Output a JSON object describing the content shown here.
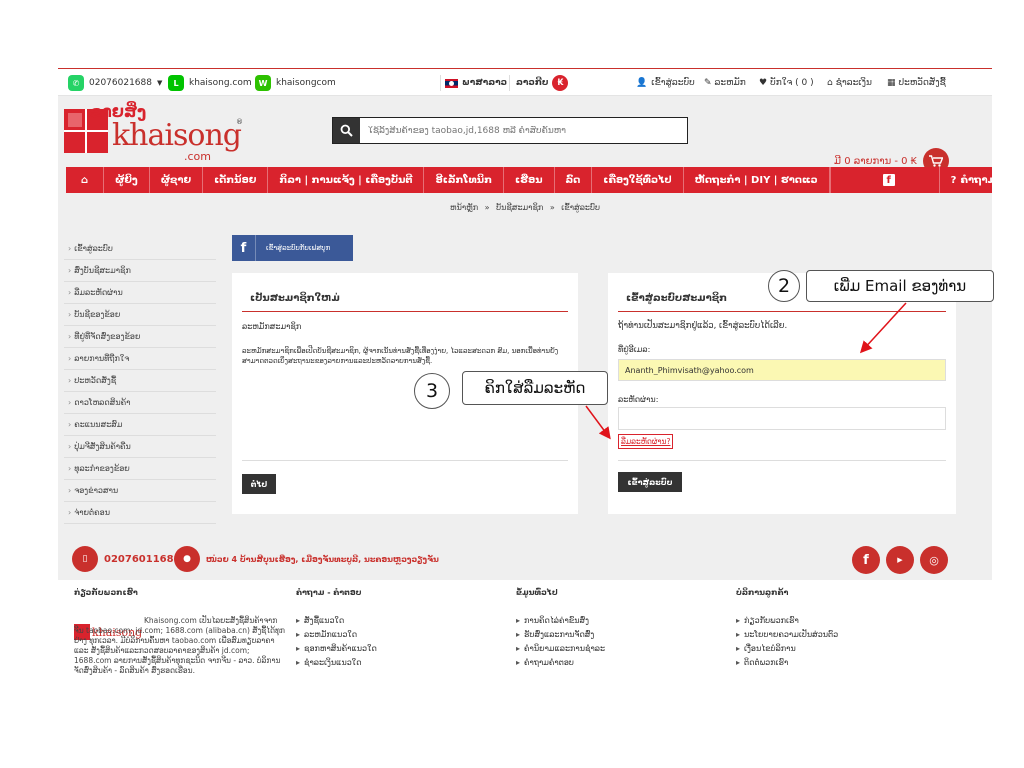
{
  "topbar": {
    "phone": "02076021688",
    "line_id": "khaisong.com",
    "wechat_id": "khaisongcom",
    "language": "ພາສາລາວ",
    "currency": "ລາວກີບ",
    "currency_symbol": "₭",
    "login": "ເຂົ້າສູ່ລະບົບ",
    "register": "ລະຫມັກ",
    "wishlist": "ບັກໃຈ ( 0 )",
    "checkout": "ຊຳລະເງິນ",
    "history": "ປະຫວັດສັ່ງຊື້"
  },
  "header": {
    "logo_lao": "ຂາຍສິ່ງ",
    "logo_main": "khaisong",
    "logo_com": ".com",
    "logo_reg": "®",
    "search_placeholder": "ໃຊ້ລິ້ງສິນຄ້າຂອງ taobao,jd,1688 ຫລື ຄຳສັບຄົ້ນຫາ",
    "cart_text": "ມີ 0 ລາຍການ - 0 ₭"
  },
  "nav": {
    "items": [
      "ຜູ້ຍິງ",
      "ຜູ້ຊາຍ",
      "ເດັກນ້ອຍ",
      "ກິລາ | ການແຈ້ງ | ເຄື່ອງບັນຕີ",
      "ອີເລັກໂທນິກ",
      "ເຮືອນ",
      "ລົດ",
      "ເຄື່ອງໃຊ້ທົ່ວໄປ",
      "ຫັດຖະກຳ | DIY | ຮາດແວ"
    ],
    "help": "ຄຳຖາມທີ່ພົບຫຼາຍ"
  },
  "breadcrumb": {
    "home": "ຫນ້າຫຼັກ",
    "account": "ບັນຊີສະມາຊິກ",
    "current": "ເຂົ້າສູ່ລະບົບ",
    "sep": "»"
  },
  "sidebar": {
    "items": [
      "ເຂົ້າສູ່ລະບົບ",
      "ສົ່ງບັນຊີສະມາຊິກ",
      "ລືມລະຫັດຜ່ານ",
      "ບັນຊີຂອງຂ້ອຍ",
      "ທີ່ຢູ່ທີ່ຈັດສົ່ງຂອງຂ້ອຍ",
      "ລາຍການທີ່ຖືກໃຈ",
      "ປະຫວັດສັ່ງຊື້",
      "ດາວໂຫລດສິນຄ້າ",
      "ຄະແນນສະສົມ",
      "ປຸ່ມຈີສັ່ງສິນຄ້າຄືນ",
      "ທຸລະກຳຂອງຂ້ອຍ",
      "ຈອງຂ່າວສານ",
      "ຈ່າຍຕໍ່ຄອນ"
    ]
  },
  "facebook_login": "ເຂົ້າສູ່ລະບົບກັບເຟສບຸກ",
  "new_customer": {
    "heading": "ເປັນສະມາຊິກໃຫມ່",
    "subheading": "ລະຫມັກສະມາຊິກ",
    "body": "ລະຫມັກສະມາຊິກເພື່ອເປີດບັນຊີສະມາຊິກ, ຜູ້ຈາກເນັ້ນທ່ານສັ່ງຊື້ເທື່ອງງ່າຍ, ໄວແລະສະດວກ ສົມ, ນອກເນື້ອທ່ານຍັງສາມາດຕວດເບິ່ງສະຖານະຂອງລາຍການແລະປະຫວັດລາຍການສັ່ງຊື້.",
    "continue_button": "ຕໍ່ໄປ"
  },
  "login": {
    "heading": "ເຂົ້າສູ່ລະບົບສະມາຊິກ",
    "intro": "ຖ້າທ່ານເປັນສະມາຊິກຢູ່ແລ້ວ, ເຂົ້າສູ່ລະບົບໄດ້ເລີຍ.",
    "email_label": "ທີ່ຢູ່ອີເມລ:",
    "email_value": "Ananth_Phimvisath@yahoo.com",
    "password_label": "ລະຫັດຜ່ານ:",
    "password_value": "",
    "forgot_link": "ລືມລະຫັດຜ່ານ?",
    "login_button": "ເຂົ້າສູ່ລະບົບ"
  },
  "footer": {
    "phone": "02076011688",
    "address": "ໜ່ວຍ 4 ບ້ານສີບຸນເຮືອງ, ເມືອງຈັນທະບູລີ, ນະຄອນຫຼວງວຽງຈັນ",
    "about_title": "ກ່ຽວກັບພວກເຮົາ",
    "about_text": "Khaisong.com ເປັນໄລຍະສັ່ງຊື້ສິນຄ້າຈາກຈີນ taobao.com; jd.com; 1688.com (alibaba.cn) ສັ່ງຊື້ໄດ້ທຸກຢ່າງ ທຸກເວລາ. ມີບໍລິການຄົ້ນຫາ taobao.com ເພື່ອສົມທຽບລາຄາ ແລະ ສັ່ງຊື້ສິນຄ້າແລະກວດສອບລາຄາຂອງສິນຄ້າ jd.com; 1688.com ລາຍການສັ່ງຊື້ສິນຄ້າທຸກຊະນິດ ຈາກຈີນ - ລາວ. ບໍລິການຈັດສົ່ງສິນຄ້າ - ລົດສິນຄ້າ ສົ່ງຮອດເຮືອນ.",
    "qa_title": "ຄຳຖາມ - ຄຳຕອບ",
    "qa_items": [
      "ສັ່ງຊື້ແນວໃດ",
      "ລະຫມັກແນວໃດ",
      "ຊອກຫາສິນຄ້າແນວໃດ",
      "ຊໍາລະເງິນແນວໃດ"
    ],
    "more_title": "ຂໍ້ມູນທົ່ວໄປ",
    "more_items": [
      "ການຄິດໄລ່ຄ່າຂົນສົ່ງ",
      "ຮັບສົ່ງແລະການຈັດສົ່ງ",
      "ຄຳນິຍາມແລະການຊໍາລະ",
      "ຄຳຖາມຄຳຕອບ"
    ],
    "service_title": "ບໍລິການລູກຄ້າ",
    "service_items": [
      "ກ່ຽວກັບພວກເຮົາ",
      "ນະໂຍບາຍຄວາມເປັນສ່ວນຕົວ",
      "ເງື່ອນໄຂບໍລິການ",
      "ຕິດຕໍ່ພວກເຮົາ"
    ]
  },
  "annotations": {
    "step2_number": "2",
    "step2_text": "ເພີ່ມ Email ຂອງທ່ານ",
    "step3_number": "3",
    "step3_text": "ຄິກໃສ່ລືມລະຫັດ"
  },
  "colors": {
    "brand_red": "#d9232d",
    "highlight_yellow": "#fbf8b3",
    "dark_button": "#333333",
    "facebook_blue": "#3b5998"
  }
}
